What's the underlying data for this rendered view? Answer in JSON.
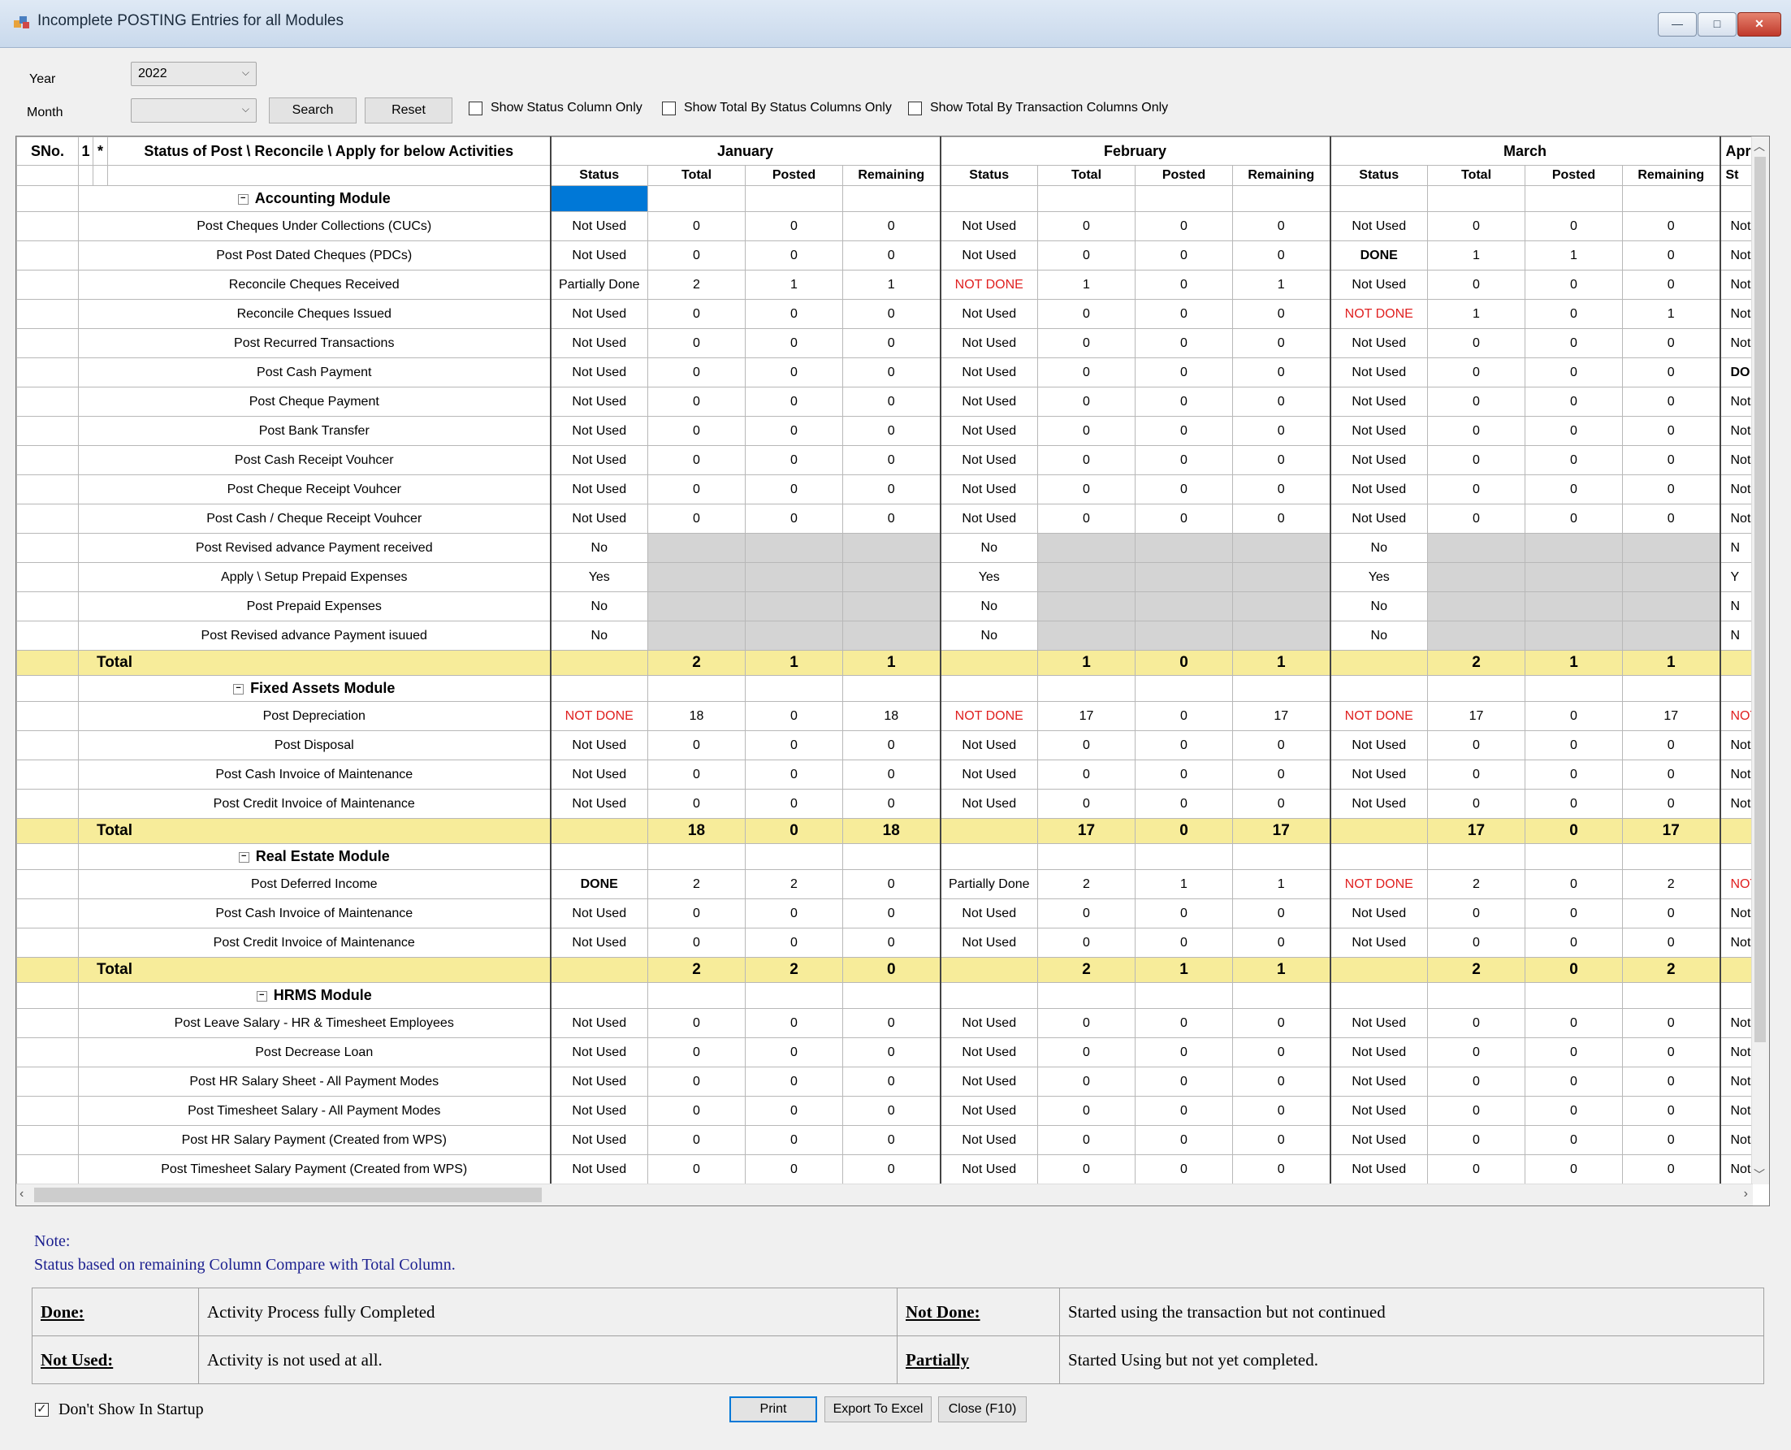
{
  "window": {
    "title": "Incomplete POSTING Entries for all Modules",
    "controls": [
      "—",
      "□",
      "✕"
    ]
  },
  "filters": {
    "year_label": "Year",
    "year_value": "2022",
    "month_label": "Month",
    "month_value": "",
    "search_label": "Search",
    "reset_label": "Reset",
    "checkboxes": [
      {
        "label": "Show Status Column Only",
        "checked": false
      },
      {
        "label": "Show Total By Status Columns Only",
        "checked": false
      },
      {
        "label": "Show Total By Transaction Columns Only",
        "checked": false
      }
    ]
  },
  "grid": {
    "col_sno": "SNo.",
    "col_1": "1",
    "col_star": "*",
    "col_activity": "Status of Post \\ Reconcile \\ Apply for below Activities",
    "months": [
      "January",
      "February",
      "March",
      "April"
    ],
    "subcols": [
      "Status",
      "Total",
      "Posted",
      "Remaining"
    ],
    "april_partial_status": "St",
    "total_label": "Total",
    "modules": [
      {
        "name": "Accounting Module",
        "rows": [
          {
            "activity": "Post Cheques Under Collections (CUCs)",
            "m": [
              [
                "Not Used",
                "0",
                "0",
                "0"
              ],
              [
                "Not Used",
                "0",
                "0",
                "0"
              ],
              [
                "Not Used",
                "0",
                "0",
                "0"
              ],
              [
                "Not"
              ]
            ]
          },
          {
            "activity": "Post Post Dated Cheques (PDCs)",
            "m": [
              [
                "Not Used",
                "0",
                "0",
                "0"
              ],
              [
                "Not Used",
                "0",
                "0",
                "0"
              ],
              [
                "DONE",
                "1",
                "1",
                "0"
              ],
              [
                "Not"
              ]
            ]
          },
          {
            "activity": "Reconcile Cheques Received",
            "m": [
              [
                "Partially Done",
                "2",
                "1",
                "1"
              ],
              [
                "NOT DONE",
                "1",
                "0",
                "1"
              ],
              [
                "Not Used",
                "0",
                "0",
                "0"
              ],
              [
                "Not"
              ]
            ]
          },
          {
            "activity": "Reconcile Cheques Issued",
            "m": [
              [
                "Not Used",
                "0",
                "0",
                "0"
              ],
              [
                "Not Used",
                "0",
                "0",
                "0"
              ],
              [
                "NOT DONE",
                "1",
                "0",
                "1"
              ],
              [
                "Not"
              ]
            ]
          },
          {
            "activity": "Post Recurred Transactions",
            "m": [
              [
                "Not Used",
                "0",
                "0",
                "0"
              ],
              [
                "Not Used",
                "0",
                "0",
                "0"
              ],
              [
                "Not Used",
                "0",
                "0",
                "0"
              ],
              [
                "Not"
              ]
            ]
          },
          {
            "activity": "Post Cash Payment",
            "m": [
              [
                "Not Used",
                "0",
                "0",
                "0"
              ],
              [
                "Not Used",
                "0",
                "0",
                "0"
              ],
              [
                "Not Used",
                "0",
                "0",
                "0"
              ],
              [
                "DO"
              ]
            ]
          },
          {
            "activity": "Post Cheque Payment",
            "m": [
              [
                "Not Used",
                "0",
                "0",
                "0"
              ],
              [
                "Not Used",
                "0",
                "0",
                "0"
              ],
              [
                "Not Used",
                "0",
                "0",
                "0"
              ],
              [
                "Not"
              ]
            ]
          },
          {
            "activity": "Post Bank Transfer",
            "m": [
              [
                "Not Used",
                "0",
                "0",
                "0"
              ],
              [
                "Not Used",
                "0",
                "0",
                "0"
              ],
              [
                "Not Used",
                "0",
                "0",
                "0"
              ],
              [
                "Not"
              ]
            ]
          },
          {
            "activity": "Post Cash Receipt Vouhcer",
            "m": [
              [
                "Not Used",
                "0",
                "0",
                "0"
              ],
              [
                "Not Used",
                "0",
                "0",
                "0"
              ],
              [
                "Not Used",
                "0",
                "0",
                "0"
              ],
              [
                "Not"
              ]
            ]
          },
          {
            "activity": "Post Cheque Receipt Vouhcer",
            "m": [
              [
                "Not Used",
                "0",
                "0",
                "0"
              ],
              [
                "Not Used",
                "0",
                "0",
                "0"
              ],
              [
                "Not Used",
                "0",
                "0",
                "0"
              ],
              [
                "Not"
              ]
            ]
          },
          {
            "activity": "Post Cash / Cheque Receipt Vouhcer",
            "m": [
              [
                "Not Used",
                "0",
                "0",
                "0"
              ],
              [
                "Not Used",
                "0",
                "0",
                "0"
              ],
              [
                "Not Used",
                "0",
                "0",
                "0"
              ],
              [
                "Not"
              ]
            ]
          },
          {
            "activity": "Post Revised advance Payment received",
            "m": [
              [
                "No"
              ],
              [
                "No"
              ],
              [
                "No"
              ],
              [
                "N"
              ]
            ]
          },
          {
            "activity": "Apply \\ Setup Prepaid Expenses",
            "m": [
              [
                "Yes"
              ],
              [
                "Yes"
              ],
              [
                "Yes"
              ],
              [
                "Y"
              ]
            ]
          },
          {
            "activity": "Post Prepaid Expenses",
            "m": [
              [
                "No"
              ],
              [
                "No"
              ],
              [
                "No"
              ],
              [
                "N"
              ]
            ]
          },
          {
            "activity": "Post Revised advance Payment isuued",
            "m": [
              [
                "No"
              ],
              [
                "No"
              ],
              [
                "No"
              ],
              [
                "N"
              ]
            ]
          }
        ],
        "total": [
          [
            "",
            "2",
            "1",
            "1"
          ],
          [
            "",
            "1",
            "0",
            "1"
          ],
          [
            "",
            "2",
            "1",
            "1"
          ],
          [
            ""
          ]
        ]
      },
      {
        "name": "Fixed Assets Module",
        "rows": [
          {
            "activity": "Post Depreciation",
            "m": [
              [
                "NOT DONE",
                "18",
                "0",
                "18"
              ],
              [
                "NOT DONE",
                "17",
                "0",
                "17"
              ],
              [
                "NOT DONE",
                "17",
                "0",
                "17"
              ],
              [
                "NOT"
              ]
            ]
          },
          {
            "activity": "Post Disposal",
            "m": [
              [
                "Not Used",
                "0",
                "0",
                "0"
              ],
              [
                "Not Used",
                "0",
                "0",
                "0"
              ],
              [
                "Not Used",
                "0",
                "0",
                "0"
              ],
              [
                "Not"
              ]
            ]
          },
          {
            "activity": "Post Cash Invoice of Maintenance",
            "m": [
              [
                "Not Used",
                "0",
                "0",
                "0"
              ],
              [
                "Not Used",
                "0",
                "0",
                "0"
              ],
              [
                "Not Used",
                "0",
                "0",
                "0"
              ],
              [
                "Not"
              ]
            ]
          },
          {
            "activity": "Post Credit Invoice of Maintenance",
            "m": [
              [
                "Not Used",
                "0",
                "0",
                "0"
              ],
              [
                "Not Used",
                "0",
                "0",
                "0"
              ],
              [
                "Not Used",
                "0",
                "0",
                "0"
              ],
              [
                "Not"
              ]
            ]
          }
        ],
        "total": [
          [
            "",
            "18",
            "0",
            "18"
          ],
          [
            "",
            "17",
            "0",
            "17"
          ],
          [
            "",
            "17",
            "0",
            "17"
          ],
          [
            ""
          ]
        ]
      },
      {
        "name": "Real Estate Module",
        "rows": [
          {
            "activity": "Post Deferred Income",
            "m": [
              [
                "DONE",
                "2",
                "2",
                "0"
              ],
              [
                "Partially Done",
                "2",
                "1",
                "1"
              ],
              [
                "NOT DONE",
                "2",
                "0",
                "2"
              ],
              [
                "NOT"
              ]
            ]
          },
          {
            "activity": "Post Cash Invoice of Maintenance",
            "m": [
              [
                "Not Used",
                "0",
                "0",
                "0"
              ],
              [
                "Not Used",
                "0",
                "0",
                "0"
              ],
              [
                "Not Used",
                "0",
                "0",
                "0"
              ],
              [
                "Not"
              ]
            ]
          },
          {
            "activity": "Post Credit Invoice of Maintenance",
            "m": [
              [
                "Not Used",
                "0",
                "0",
                "0"
              ],
              [
                "Not Used",
                "0",
                "0",
                "0"
              ],
              [
                "Not Used",
                "0",
                "0",
                "0"
              ],
              [
                "Not"
              ]
            ]
          }
        ],
        "total": [
          [
            "",
            "2",
            "2",
            "0"
          ],
          [
            "",
            "2",
            "1",
            "1"
          ],
          [
            "",
            "2",
            "0",
            "2"
          ],
          [
            ""
          ]
        ]
      },
      {
        "name": "HRMS Module",
        "rows": [
          {
            "activity": "Post Leave Salary - HR & Timesheet Employees",
            "m": [
              [
                "Not Used",
                "0",
                "0",
                "0"
              ],
              [
                "Not Used",
                "0",
                "0",
                "0"
              ],
              [
                "Not Used",
                "0",
                "0",
                "0"
              ],
              [
                "Not"
              ]
            ]
          },
          {
            "activity": "Post Decrease Loan",
            "m": [
              [
                "Not Used",
                "0",
                "0",
                "0"
              ],
              [
                "Not Used",
                "0",
                "0",
                "0"
              ],
              [
                "Not Used",
                "0",
                "0",
                "0"
              ],
              [
                "Not"
              ]
            ]
          },
          {
            "activity": "Post HR Salary Sheet - All Payment Modes",
            "m": [
              [
                "Not Used",
                "0",
                "0",
                "0"
              ],
              [
                "Not Used",
                "0",
                "0",
                "0"
              ],
              [
                "Not Used",
                "0",
                "0",
                "0"
              ],
              [
                "Not"
              ]
            ]
          },
          {
            "activity": "Post Timesheet Salary - All Payment Modes",
            "m": [
              [
                "Not Used",
                "0",
                "0",
                "0"
              ],
              [
                "Not Used",
                "0",
                "0",
                "0"
              ],
              [
                "Not Used",
                "0",
                "0",
                "0"
              ],
              [
                "Not"
              ]
            ]
          },
          {
            "activity": "Post HR Salary Payment (Created from WPS)",
            "m": [
              [
                "Not Used",
                "0",
                "0",
                "0"
              ],
              [
                "Not Used",
                "0",
                "0",
                "0"
              ],
              [
                "Not Used",
                "0",
                "0",
                "0"
              ],
              [
                "Not"
              ]
            ]
          },
          {
            "activity": "Post Timesheet Salary Payment (Created from WPS)",
            "m": [
              [
                "Not Used",
                "0",
                "0",
                "0"
              ],
              [
                "Not Used",
                "0",
                "0",
                "0"
              ],
              [
                "Not Used",
                "0",
                "0",
                "0"
              ],
              [
                "Not"
              ]
            ]
          }
        ],
        "total": null
      }
    ]
  },
  "note": {
    "title": "Note:",
    "text": "Status based on remaining Column Compare with Total Column.",
    "legend": [
      {
        "key": "Done:",
        "desc": "Activity Process fully Completed"
      },
      {
        "key": "Not Done:",
        "desc": "Started using the transaction but not continued"
      },
      {
        "key": "Not Used:",
        "desc": "Activity is not used at all."
      },
      {
        "key": "Partially",
        "desc": "Started Using but not yet completed."
      }
    ]
  },
  "footer": {
    "dont_show_label": "Don't Show In Startup",
    "dont_show_checked": true,
    "print_label": "Print",
    "export_label": "Export To Excel",
    "close_label": "Close (F10)"
  },
  "colors": {
    "not_done": "#e02020",
    "total_row": "#f7ec9a",
    "selected_cell": "#0078d7",
    "disabled_cell": "#d4d4d4"
  }
}
